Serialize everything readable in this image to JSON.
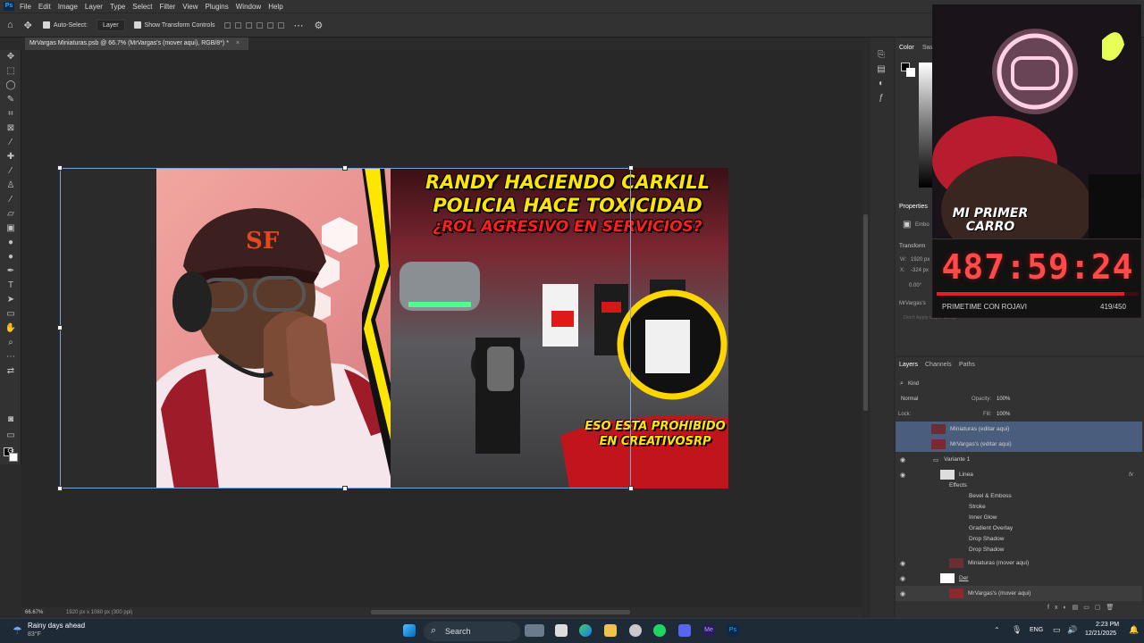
{
  "menubar": {
    "items": [
      "File",
      "Edit",
      "Image",
      "Layer",
      "Type",
      "Select",
      "Filter",
      "View",
      "Plugins",
      "Window",
      "Help"
    ]
  },
  "options": {
    "auto_select_label": "Auto-Select:",
    "auto_select_value": "Layer",
    "show_transform_label": "Show Transform Controls"
  },
  "doc": {
    "tab_title": "MrVargas Miniaturas.psb @ 66.7% (MrVargas's (mover aqui), RGB/8*) *"
  },
  "status": {
    "zoom": "66.67%",
    "dims": "1920 px x 1080 px (300 ppi)"
  },
  "thumbnail": {
    "title1": "RANDY HACIENDO CARKILL",
    "title2": "POLICIA HACE TOXICIDAD",
    "title3": "¿ROL AGRESIVO EN SERVICIOS?",
    "caption1": "ESO ESTA PROHIBIDO",
    "caption2": "EN CREATIVOSRP"
  },
  "panels": {
    "color_tab": "Color",
    "swatches_tab": "Swa",
    "properties_tab": "Properties",
    "emboss_label": "Embo",
    "transform_label": "Transform",
    "w_label": "W:",
    "w_value": "1920 px",
    "x_label": "X:",
    "x_value": "-324 px",
    "angle_value": "0.00°",
    "smart_label": "MrVargas's",
    "dont_apply": "Don't Apply Layer Comp"
  },
  "layers": {
    "tabs": [
      "Layers",
      "Channels",
      "Paths"
    ],
    "kind": "Kind",
    "blend": "Normal",
    "opacity_label": "Opacity:",
    "opacity_value": "100%",
    "lock_label": "Lock:",
    "fill_label": "Fill:",
    "fill_value": "100%",
    "rows": [
      {
        "name": "Miniaturas (editar aqui)",
        "eye": false
      },
      {
        "name": "MrVargas's (editar aqui)",
        "eye": false
      },
      {
        "name": "Variante 1",
        "eye": true
      },
      {
        "name": "Linea",
        "eye": true
      },
      {
        "name": "Effects",
        "eye": false
      },
      {
        "name": "Bevel & Emboss",
        "eye": false
      },
      {
        "name": "Stroke",
        "eye": false
      },
      {
        "name": "Inner Glow",
        "eye": false
      },
      {
        "name": "Gradient Overlay",
        "eye": false
      },
      {
        "name": "Drop Shadow",
        "eye": false
      },
      {
        "name": "Drop Shadow",
        "eye": false
      },
      {
        "name": "Miniaturas (mover aqui)",
        "eye": true
      },
      {
        "name": "Der",
        "eye": true
      },
      {
        "name": "MrVargas's (mover aqui)",
        "eye": true
      }
    ]
  },
  "stream": {
    "overlay_title1": "MI PRIMER",
    "overlay_title2": "CARRO",
    "timer": "487:59:24",
    "goal_label": "PRIMETIME CON ROJAVI",
    "goal_count": "419/450"
  },
  "taskbar": {
    "weather_title": "Rainy days ahead",
    "weather_temp": "83°F",
    "search": "Search",
    "lang": "ENG",
    "time": "2:23 PM",
    "date": "12/21/2025"
  },
  "colors": {
    "accent": "#31a8ff",
    "timer": "#ff3b3b",
    "title_yellow": "#ffe600",
    "title_red": "#ff1e1e"
  }
}
